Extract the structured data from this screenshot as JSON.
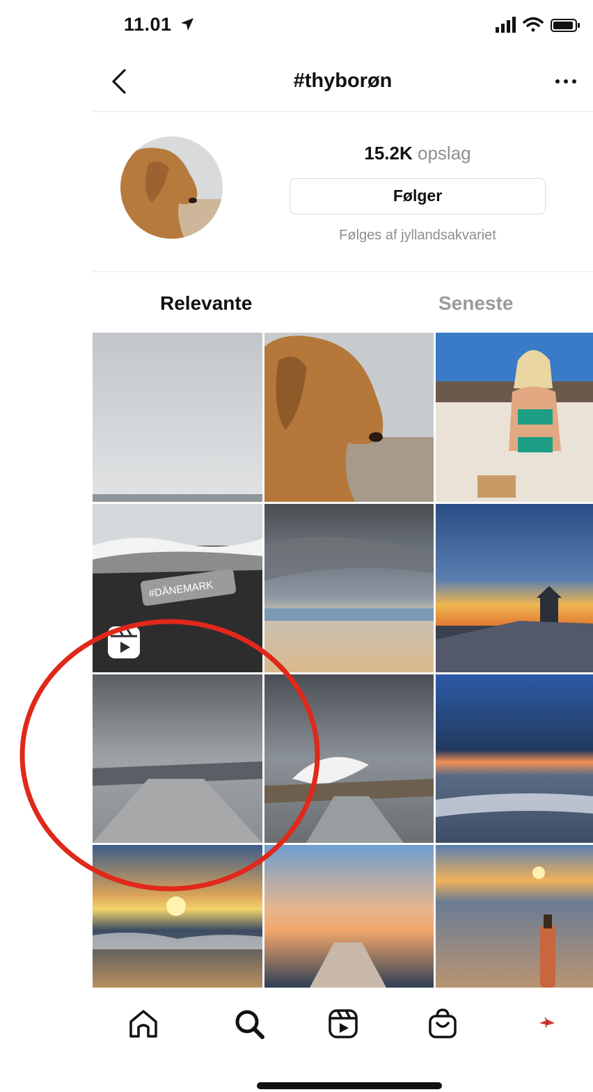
{
  "status_bar": {
    "time": "11.01",
    "location_icon": "location-arrow-icon",
    "signal_icon": "cellular-signal-icon",
    "wifi_icon": "wifi-icon",
    "battery_icon": "battery-icon"
  },
  "header": {
    "back_icon": "chevron-left-icon",
    "title": "#thyborøn",
    "more_icon": "ellipsis-icon"
  },
  "profile": {
    "posts_count": "15.2K",
    "posts_label": "opslag",
    "follow_button": "Følger",
    "followed_by": "Følges af jyllandsakvariet"
  },
  "tabs": [
    {
      "label": "Relevante",
      "active": true
    },
    {
      "label": "Seneste",
      "active": false
    }
  ],
  "grid": {
    "tiles": [
      {
        "subject": "cloudy sky over grey sea"
      },
      {
        "subject": "golden retriever on beach"
      },
      {
        "subject": "woman in bikini on sand"
      },
      {
        "subject": "waves on dark pebble beach",
        "sticker_text": "#DÄNEMARK",
        "reel_icon": "reels-icon"
      },
      {
        "subject": "dramatic clouds over beach"
      },
      {
        "subject": "lighthouse at sunset"
      },
      {
        "subject": "stormy pier"
      },
      {
        "subject": "wave crashing over pier"
      },
      {
        "subject": "blue sunset over sea"
      },
      {
        "subject": "sunset over sea waves"
      },
      {
        "subject": "pier into sunset sea"
      },
      {
        "subject": "bottle on beach at sunset"
      }
    ]
  },
  "bottom_nav": {
    "items": [
      "home-icon",
      "search-icon",
      "reels-icon",
      "shop-icon",
      "profile-avatar"
    ]
  },
  "annotation": {
    "color": "#e0281b"
  },
  "colors": {
    "muted": "#8e8e8e",
    "border": "#dbdbdb"
  }
}
